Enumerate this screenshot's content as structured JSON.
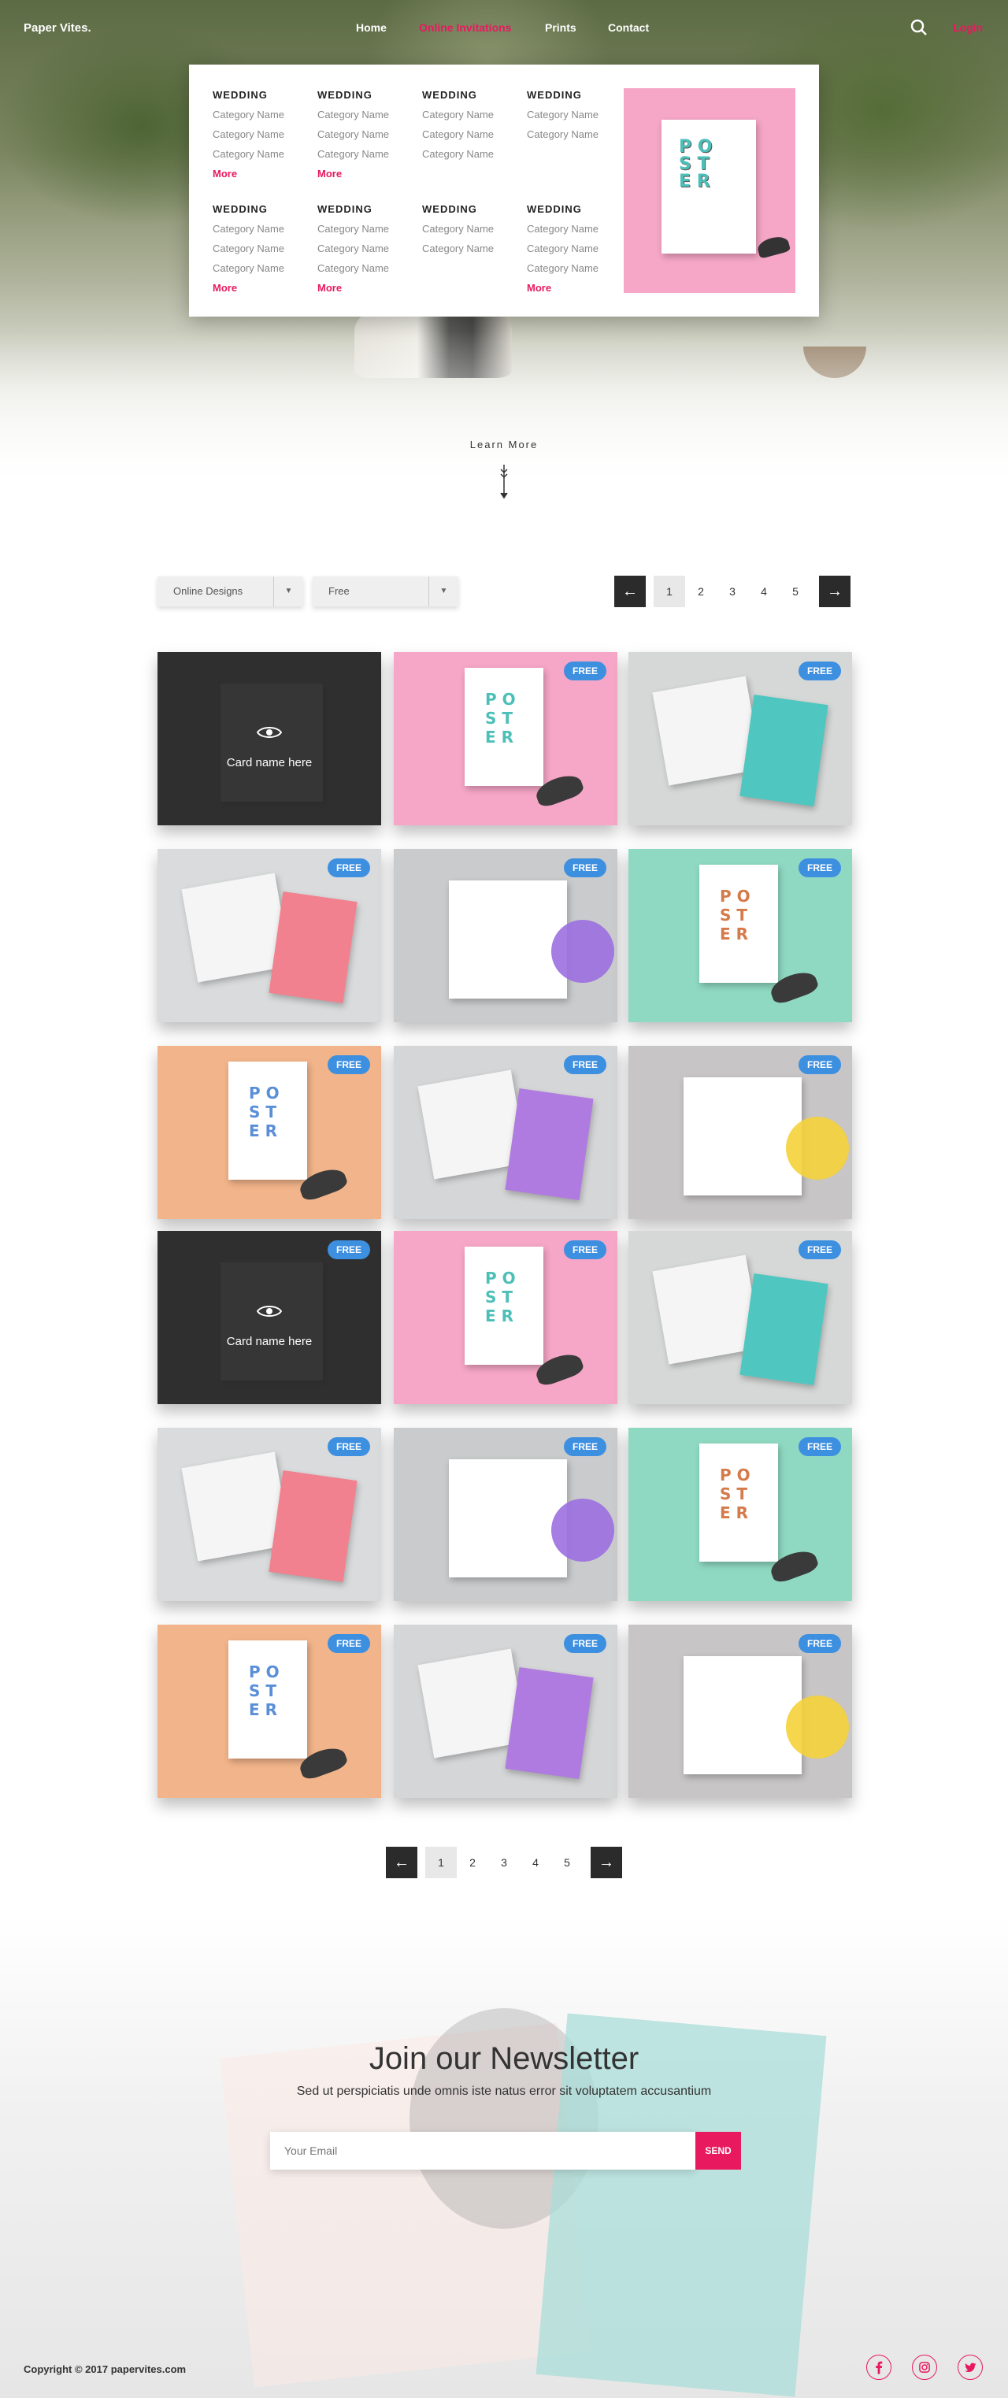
{
  "nav": {
    "logo": "Paper Vites.",
    "links": [
      "Home",
      "Online Invitations",
      "Prints",
      "Contact"
    ],
    "active_index": 1,
    "login": "Login",
    "accent": "#e8195f"
  },
  "mega_menu": {
    "columns": [
      {
        "heading": "WEDDING",
        "items": [
          "Category Name",
          "Category Name",
          "Category Name"
        ],
        "more": "More"
      },
      {
        "heading": "WEDDING",
        "items": [
          "Category Name",
          "Category Name",
          "Category Name"
        ],
        "more": "More"
      },
      {
        "heading": "WEDDING",
        "items": [
          "Category Name",
          "Category Name",
          "Category Name"
        ],
        "more": ""
      },
      {
        "heading": "WEDDING",
        "items": [
          "Category Name",
          "Category Name"
        ],
        "more": ""
      },
      {
        "heading": "WEDDING",
        "items": [
          "Category Name",
          "Category Name",
          "Category Name"
        ],
        "more": "More"
      },
      {
        "heading": "WEDDING",
        "items": [
          "Category Name",
          "Category Name",
          "Category Name"
        ],
        "more": "More"
      },
      {
        "heading": "WEDDING",
        "items": [
          "Category Name",
          "Category Name"
        ],
        "more": ""
      },
      {
        "heading": "WEDDING",
        "items": [
          "Category Name",
          "Category Name",
          "Category Name"
        ],
        "more": "More"
      }
    ],
    "image_text": "POSTER"
  },
  "hero": {
    "learn_more": "Learn More"
  },
  "filters": {
    "design": "Online Designs",
    "price": "Free"
  },
  "pagination": {
    "prev": "←",
    "next": "→",
    "pages": [
      "1",
      "2",
      "3",
      "4",
      "5"
    ],
    "current": "1"
  },
  "cards": [
    {
      "kind": "overlay",
      "name": "Card name here",
      "badge": ""
    },
    {
      "kind": "poster-pink",
      "badge": "FREE"
    },
    {
      "kind": "teal-cards",
      "badge": "FREE"
    },
    {
      "kind": "pink-cards",
      "badge": "FREE"
    },
    {
      "kind": "gift-grey",
      "badge": "FREE"
    },
    {
      "kind": "poster-teal",
      "badge": "FREE"
    },
    {
      "kind": "poster-orange",
      "badge": "FREE"
    },
    {
      "kind": "purple-cards",
      "badge": "FREE"
    },
    {
      "kind": "gift-yellow",
      "badge": "FREE"
    },
    {
      "kind": "overlay",
      "name": "Card name here",
      "badge": "FREE"
    },
    {
      "kind": "poster-pink",
      "badge": "FREE"
    },
    {
      "kind": "teal-cards",
      "badge": "FREE"
    },
    {
      "kind": "pink-cards",
      "badge": "FREE"
    },
    {
      "kind": "gift-grey",
      "badge": "FREE"
    },
    {
      "kind": "poster-teal",
      "badge": "FREE"
    },
    {
      "kind": "poster-orange",
      "badge": "FREE"
    },
    {
      "kind": "purple-cards",
      "badge": "FREE"
    },
    {
      "kind": "gift-yellow",
      "badge": "FREE"
    }
  ],
  "newsletter": {
    "title": "Join our Newsletter",
    "subtitle": "Sed ut perspiciatis unde omnis iste natus error sit voluptatem accusantium",
    "placeholder": "Your Email",
    "send": "SEND"
  },
  "footer": {
    "copyright": "Copyright © 2017 papervites.com",
    "social": [
      "facebook-icon",
      "instagram-icon",
      "twitter-icon"
    ]
  }
}
